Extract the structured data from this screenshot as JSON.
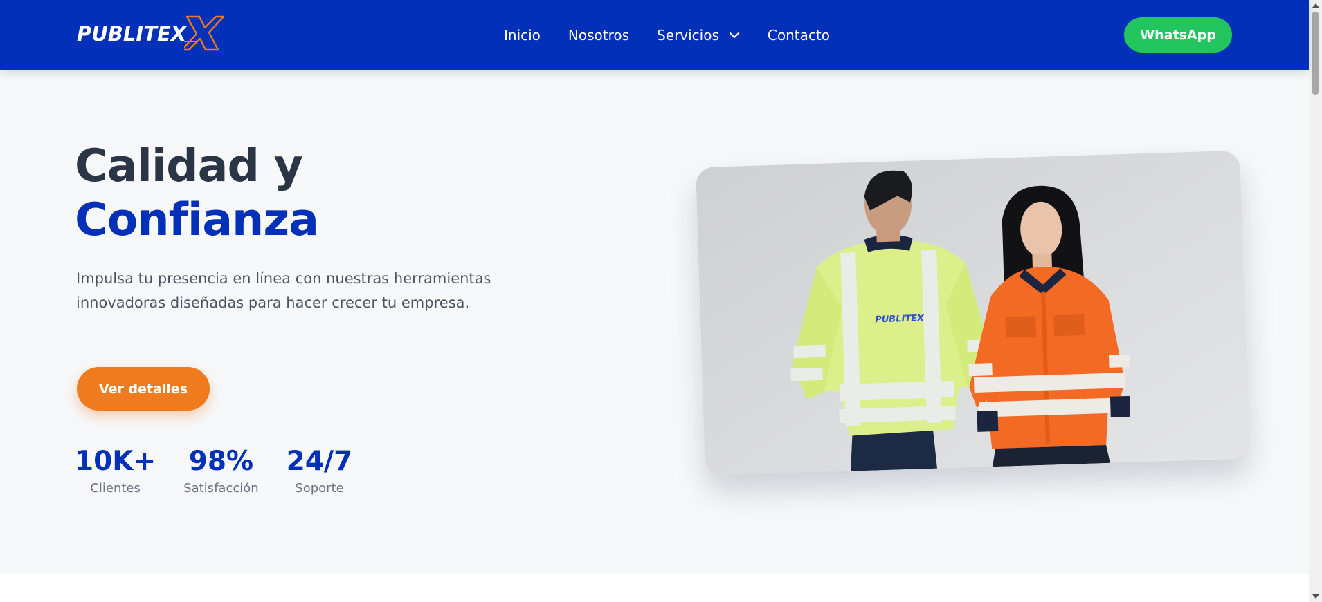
{
  "brand": {
    "name": "PUBLITEX",
    "mark": "X",
    "colors": {
      "primary": "#0230b8",
      "accent": "#f07a1e",
      "whatsapp": "#22c55e",
      "heading": "#2a3546"
    }
  },
  "nav": {
    "items": [
      {
        "label": "Inicio"
      },
      {
        "label": "Nosotros"
      },
      {
        "label": "Servicios",
        "icon": "chevron-down-icon"
      },
      {
        "label": "Contacto"
      }
    ],
    "whatsapp_label": "WhatsApp"
  },
  "hero": {
    "title_line1": "Calidad y",
    "title_line2": "Confianza",
    "description": "Impulsa tu presencia en línea con nuestras herramientas innovadoras diseñadas para hacer crecer tu empresa.",
    "cta_label": "Ver detalles",
    "stats": [
      {
        "value": "10K+",
        "label": "Clientes"
      },
      {
        "value": "98%",
        "label": "Satisfacción"
      },
      {
        "value": "24/7",
        "label": "Soporte"
      }
    ],
    "photo": {
      "alt": "Two people wearing high-visibility workwear shirts",
      "shirt_print": "PUBLITEX"
    }
  }
}
